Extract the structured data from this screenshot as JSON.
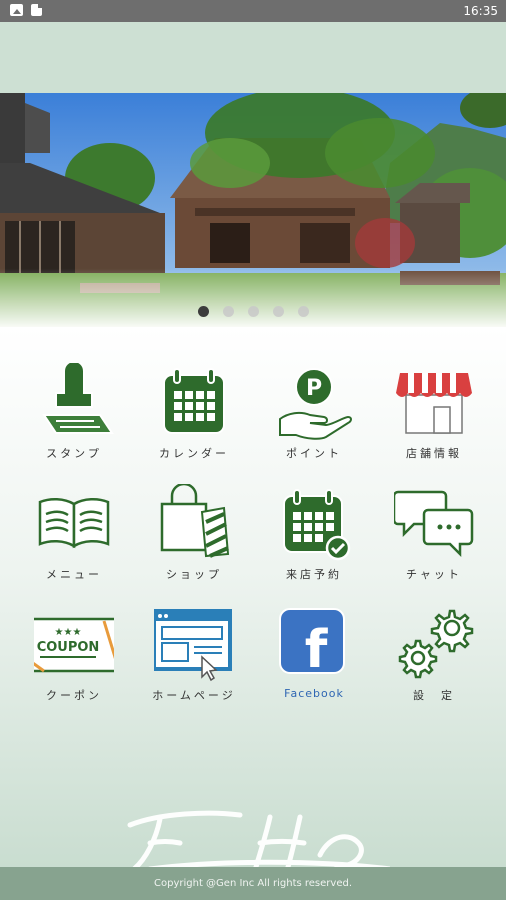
{
  "status_bar": {
    "time": "16:35"
  },
  "carousel": {
    "slide_count": 5,
    "active_index": 0
  },
  "menu": [
    {
      "label": "スタンプ",
      "icon": "stamp-icon"
    },
    {
      "label": "カレンダー",
      "icon": "calendar-icon"
    },
    {
      "label": "ポイント",
      "icon": "point-icon"
    },
    {
      "label": "店舗情報",
      "icon": "store-icon"
    },
    {
      "label": "メニュー",
      "icon": "book-icon"
    },
    {
      "label": "ショップ",
      "icon": "shopping-bag-icon"
    },
    {
      "label": "来店予約",
      "icon": "reservation-calendar-icon"
    },
    {
      "label": "チャット",
      "icon": "chat-icon"
    },
    {
      "label": "クーポン",
      "icon": "coupon-icon"
    },
    {
      "label": "ホームページ",
      "icon": "browser-icon"
    },
    {
      "label": "Facebook",
      "icon": "facebook-icon"
    },
    {
      "label": "設　定",
      "icon": "gear-icon"
    }
  ],
  "icon_text": {
    "point_letter": "P",
    "coupon_stars": "★★★",
    "coupon_word": "COUPON",
    "facebook_letter": "f"
  },
  "logo": {
    "text": "Flora Ho"
  },
  "footer": {
    "copyright": "Copyright @Gen Inc All rights reserved."
  },
  "colors": {
    "green": "#2e6b2c",
    "header_band": "#cde0d3",
    "footer": "#87a38f",
    "facebook_blue": "#3b73c3"
  }
}
